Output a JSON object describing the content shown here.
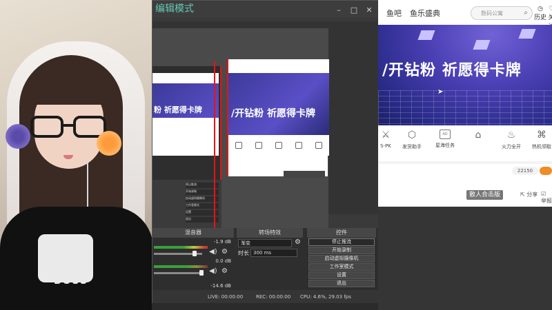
{
  "obs": {
    "title": "编辑模式",
    "preview": {
      "mini_banner": "/开钻粉 祈愿得卡牌",
      "nested_banner": "粉 祈愿得卡牌",
      "nested_menu": [
        "停止推流",
        "开始录制",
        "启动虚拟摄像机",
        "工作室模式",
        "设置",
        "退出"
      ]
    },
    "docks": {
      "mixer_title": "混音器",
      "transitions_title": "转场特效",
      "controls_title": "控件"
    },
    "mixer": {
      "track1_db": "-1.9 dB",
      "track2_db": "0.0 dB",
      "track3_db": "-14.6 dB"
    },
    "transitions": {
      "type_value": "渐变",
      "duration_label": "时长",
      "duration_value": "300 ms"
    },
    "controls": {
      "stop_stream": "停止推流",
      "start_record": "开始录制",
      "virtual_cam": "启动虚拟摄像机",
      "studio_mode": "工作室模式",
      "settings": "设置",
      "exit": "退出"
    },
    "status": {
      "live": "LIVE: 00:00:00",
      "rec": "REC: 00:00:00",
      "cpu": "CPU: 4.6%, 29.03 fps"
    }
  },
  "browser": {
    "nav": {
      "item1": "鱼吧",
      "item2": "鱼乐盛典",
      "search_placeholder": "数码公寓",
      "history": "历史",
      "follow": "关注"
    },
    "banner_text": "/开钻粉 祈愿得卡牌",
    "icons": [
      {
        "label": "S-PK",
        "icon": "pk-icon"
      },
      {
        "label": "发货助手",
        "icon": "cube-icon"
      },
      {
        "label": "星海任务",
        "icon": "ad-icon"
      },
      {
        "label": "",
        "icon": "gift-icon"
      },
      {
        "label": "火力全开",
        "icon": "fire-icon"
      },
      {
        "label": "热机领取",
        "icon": "grab-icon"
      }
    ],
    "counter": "22150",
    "badge": "散人合击版",
    "share": "分享",
    "report": "举报"
  },
  "webcam": {
    "shirt_text": "BOSS"
  }
}
